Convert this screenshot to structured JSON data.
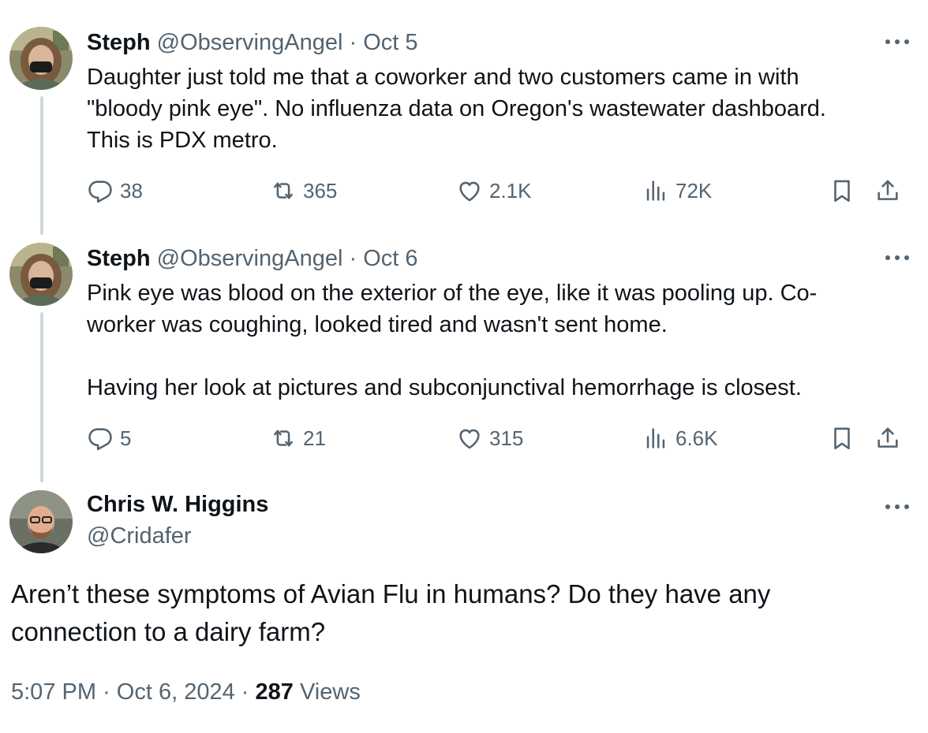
{
  "tweets": [
    {
      "name": "Steph",
      "handle": "@ObservingAngel",
      "date": "Oct 5",
      "text": "Daughter just told me that a coworker and two customers came in with\n\"bloody pink eye\".  No influenza data on Oregon's wastewater dashboard.\nThis is PDX metro.",
      "replies": "38",
      "reposts": "365",
      "likes": "2.1K",
      "views": "72K"
    },
    {
      "name": "Steph",
      "handle": "@ObservingAngel",
      "date": "Oct 6",
      "text": "Pink eye was blood on the exterior of the eye, like it was pooling up. Co-\nworker was coughing, looked tired and wasn't sent home.\n\nHaving her look at pictures and subconjunctival hemorrhage is closest.",
      "replies": "5",
      "reposts": "21",
      "likes": "315",
      "views": "6.6K"
    }
  ],
  "main_tweet": {
    "name": "Chris W. Higgins",
    "handle": "@Cridafer",
    "text": "Aren’t these symptoms of Avian Flu in humans? Do they have any\nconnection to a dairy farm?",
    "time": "5:07 PM",
    "date": "Oct 6, 2024",
    "views_count": "287",
    "views_label": "Views"
  },
  "separator": "·",
  "icons": {
    "reply": "reply-icon",
    "repost": "repost-icon",
    "like": "heart-icon",
    "views": "views-chart-icon",
    "bookmark": "bookmark-icon",
    "share": "share-icon",
    "more": "more-icon"
  },
  "colors": {
    "text": "#0f1419",
    "muted": "#536471",
    "thread_line": "#cfd9de"
  }
}
